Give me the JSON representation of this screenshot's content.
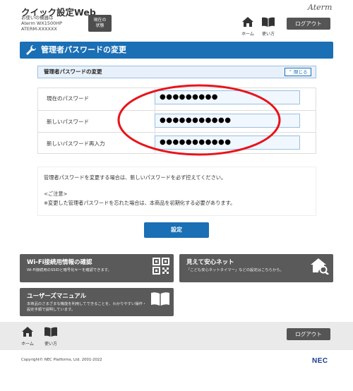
{
  "header": {
    "app_title": "クイック設定Web",
    "device_line1": "お使いの機器は",
    "device_line2": "Aterm WX1500HP",
    "device_line3": "ATERM-XXXXXX",
    "status_button_line1": "現在の",
    "status_button_line2": "状態",
    "brand": "Aterm",
    "home_label": "ホーム",
    "manual_label": "使い方",
    "logout_label": "ログアウト"
  },
  "page": {
    "title": "管理者パスワードの変更",
    "section_title": "管理者パスワードの変更",
    "close_label": "閉じる"
  },
  "form": {
    "rows": [
      {
        "label": "現在のパスワード",
        "value": "●●●●●●●●●"
      },
      {
        "label": "新しいパスワード",
        "value": "●●●●●●●●●●●"
      },
      {
        "label": "新しいパスワード再入力",
        "value": "●●●●●●●●●●●"
      }
    ]
  },
  "notice": {
    "line1": "管理者パスワードを変更する場合は、新しいパスワードを必ず控えてください。",
    "line2": "<ご注意>",
    "line3": "※変更した管理者パスワードを忘れた場合は、本商品を初期化する必要があります。"
  },
  "actions": {
    "save_label": "設定"
  },
  "cards": [
    {
      "title": "Wi-Fi接続用情報の確認",
      "desc": "Wi-Fi接続用のSSIDと暗号化キーを確認できます。",
      "icon": "qr-code-icon"
    },
    {
      "title": "見えて安心ネット",
      "desc": "「こども安心ネットタイマー」などの設定はこちらから。",
      "icon": "house-search-icon"
    },
    {
      "title": "ユーザーズマニュアル",
      "desc": "本商品のさまざまな機能を利用してできることを、わかりやすい操作・設定手順で説明しています。",
      "icon": "book-icon"
    }
  ],
  "footer": {
    "home_label": "ホーム",
    "manual_label": "使い方",
    "logout_label": "ログアウト",
    "copyright": "Copyright© NEC Platforms, Ltd. 2001-2022",
    "nec": "NEC"
  },
  "colors": {
    "primary": "#1a6fb5",
    "card_bg": "#5a5a5a",
    "annotation": "#e8141c"
  }
}
